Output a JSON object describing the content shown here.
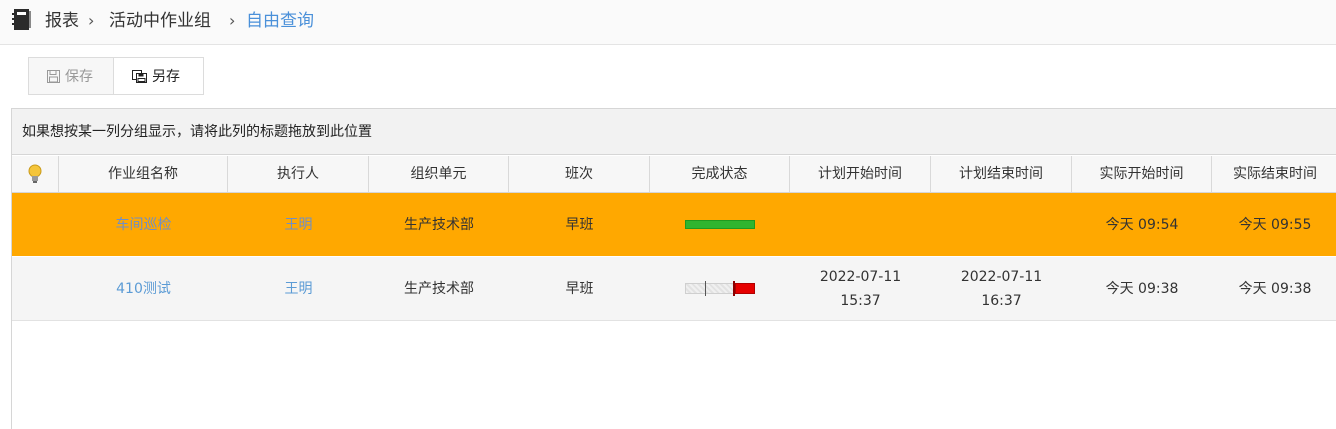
{
  "breadcrumb": {
    "items": [
      "报表",
      "活动中作业组",
      "自由查询"
    ],
    "separator": "›",
    "icon": "book-icon"
  },
  "toolbar": {
    "save_label": "保存",
    "save_as_label": "另存"
  },
  "grid": {
    "group_hint": "如果想按某一列分组显示，请将此列的标题拖放到此位置",
    "columns": [
      "作业组名称",
      "执行人",
      "组织单元",
      "班次",
      "完成状态",
      "计划开始时间",
      "计划结束时间",
      "实际开始时间",
      "实际结束时间"
    ],
    "rows": [
      {
        "name": "车间巡检",
        "executor": "王明",
        "org_unit": "生产技术部",
        "shift": "早班",
        "completion": 1.0,
        "plan_start_date": "",
        "plan_start_time": "",
        "plan_end_date": "",
        "plan_end_time": "",
        "actual_start": "今天 09:54",
        "actual_end": "今天 09:55",
        "highlight_color": "#ffa800"
      },
      {
        "name": "410测试",
        "executor": "王明",
        "org_unit": "生产技术部",
        "shift": "早班",
        "completion": 0.7,
        "plan_start_date": "2022-07-11",
        "plan_start_time": "15:37",
        "plan_end_date": "2022-07-11",
        "plan_end_time": "16:37",
        "actual_start": "今天 09:38",
        "actual_end": "今天 09:38"
      }
    ]
  },
  "colors": {
    "link": "#5b9bd5",
    "highlight_row": "#ffa800",
    "progress_complete": "#2fb52f",
    "progress_overdue": "#e60000"
  }
}
